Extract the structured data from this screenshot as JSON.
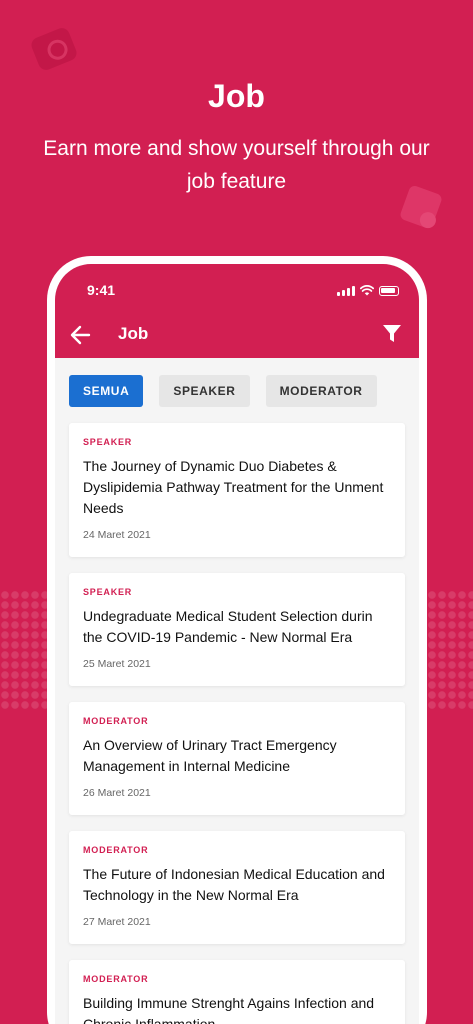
{
  "hero": {
    "title": "Job",
    "subtitle": "Earn more and show yourself through our job feature"
  },
  "status_bar": {
    "time": "9:41"
  },
  "app_bar": {
    "title": "Job",
    "back_icon": "arrow-left-icon",
    "filter_icon": "filter-icon"
  },
  "filters": [
    {
      "label": "SEMUA",
      "active": true
    },
    {
      "label": "SPEAKER",
      "active": false
    },
    {
      "label": "MODERATOR",
      "active": false
    }
  ],
  "jobs": [
    {
      "tag": "SPEAKER",
      "title": "The Journey of Dynamic Duo Diabetes & Dyslipidemia Pathway Treatment for the Unment Needs",
      "date": "24 Maret 2021"
    },
    {
      "tag": "SPEAKER",
      "title": "Undegraduate Medical Student Selection durin the COVID-19 Pandemic - New Normal Era",
      "date": "25 Maret 2021"
    },
    {
      "tag": "MODERATOR",
      "title": "An Overview of Urinary Tract Emergency Management in Internal Medicine",
      "date": "26 Maret 2021"
    },
    {
      "tag": "MODERATOR",
      "title": "The Future of Indonesian Medical Education and Technology in the New Normal Era",
      "date": "27 Maret 2021"
    },
    {
      "tag": "MODERATOR",
      "title": "Building Immune Strenght Agains Infection and Chronic Inflammation",
      "date": ""
    }
  ],
  "colors": {
    "brand": "#d21f52",
    "active_chip": "#1b6fd1",
    "chip": "#e6e6e6"
  }
}
